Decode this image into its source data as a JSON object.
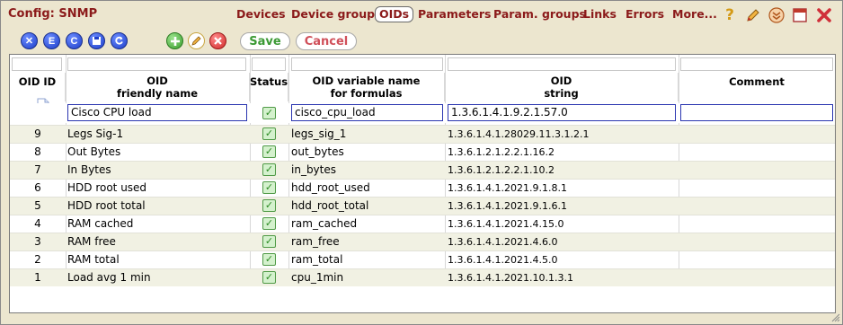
{
  "window": {
    "title": "Config: SNMP"
  },
  "nav": [
    {
      "label": "Devices",
      "active": false
    },
    {
      "label": "Device groups",
      "active": false
    },
    {
      "label": "OIDs",
      "active": true
    },
    {
      "label": "Parameters",
      "active": false
    },
    {
      "label": "Param. groups",
      "active": false
    },
    {
      "label": "Links",
      "active": false
    },
    {
      "label": "Errors",
      "active": false
    },
    {
      "label": "More...",
      "active": false
    }
  ],
  "title_icons": {
    "help": "?",
    "edit": "pencil-icon",
    "collapse": "collapse-icon",
    "maximize": "maximize-icon",
    "close": "close-icon"
  },
  "toolbar": {
    "btn_x": "✕",
    "btn_e": "E",
    "btn_c": "C",
    "btn_save_disk": "save-disk-icon",
    "btn_refresh": "refresh-icon",
    "save_label": "Save",
    "cancel_label": "Cancel"
  },
  "colors": {
    "accent_red": "#8b1a1a",
    "save_green": "#3c9a35",
    "cancel_red": "#d0505a",
    "row_alt": "#f1f1e3",
    "check_green": "#2c8a22"
  },
  "table": {
    "headers": {
      "oid_id": "OID ID",
      "friendly_1": "OID",
      "friendly_2": "friendly name",
      "status": "Status",
      "varname_1": "OID variable name",
      "varname_2": "for formulas",
      "string_1": "OID",
      "string_2": "string",
      "comment": "Comment"
    },
    "edit_row": {
      "friendly": "Cisco CPU load",
      "status": true,
      "varname": "cisco_cpu_load",
      "string": "1.3.6.1.4.1.9.2.1.57.0",
      "comment": ""
    },
    "rows": [
      {
        "id": "9",
        "friendly": "Legs Sig-1",
        "status": true,
        "varname": "legs_sig_1",
        "string": "1.3.6.1.4.1.28029.11.3.1.2.1",
        "comment": ""
      },
      {
        "id": "8",
        "friendly": "Out Bytes",
        "status": true,
        "varname": "out_bytes",
        "string": "1.3.6.1.2.1.2.2.1.16.2",
        "comment": ""
      },
      {
        "id": "7",
        "friendly": "In Bytes",
        "status": true,
        "varname": "in_bytes",
        "string": "1.3.6.1.2.1.2.2.1.10.2",
        "comment": ""
      },
      {
        "id": "6",
        "friendly": "HDD root used",
        "status": true,
        "varname": "hdd_root_used",
        "string": "1.3.6.1.4.1.2021.9.1.8.1",
        "comment": ""
      },
      {
        "id": "5",
        "friendly": "HDD root total",
        "status": true,
        "varname": "hdd_root_total",
        "string": "1.3.6.1.4.1.2021.9.1.6.1",
        "comment": ""
      },
      {
        "id": "4",
        "friendly": "RAM cached",
        "status": true,
        "varname": "ram_cached",
        "string": "1.3.6.1.4.1.2021.4.15.0",
        "comment": ""
      },
      {
        "id": "3",
        "friendly": "RAM free",
        "status": true,
        "varname": "ram_free",
        "string": "1.3.6.1.4.1.2021.4.6.0",
        "comment": ""
      },
      {
        "id": "2",
        "friendly": "RAM total",
        "status": true,
        "varname": "ram_total",
        "string": "1.3.6.1.4.1.2021.4.5.0",
        "comment": ""
      },
      {
        "id": "1",
        "friendly": "Load avg 1 min",
        "status": true,
        "varname": "cpu_1min",
        "string": "1.3.6.1.4.1.2021.10.1.3.1",
        "comment": ""
      }
    ]
  }
}
